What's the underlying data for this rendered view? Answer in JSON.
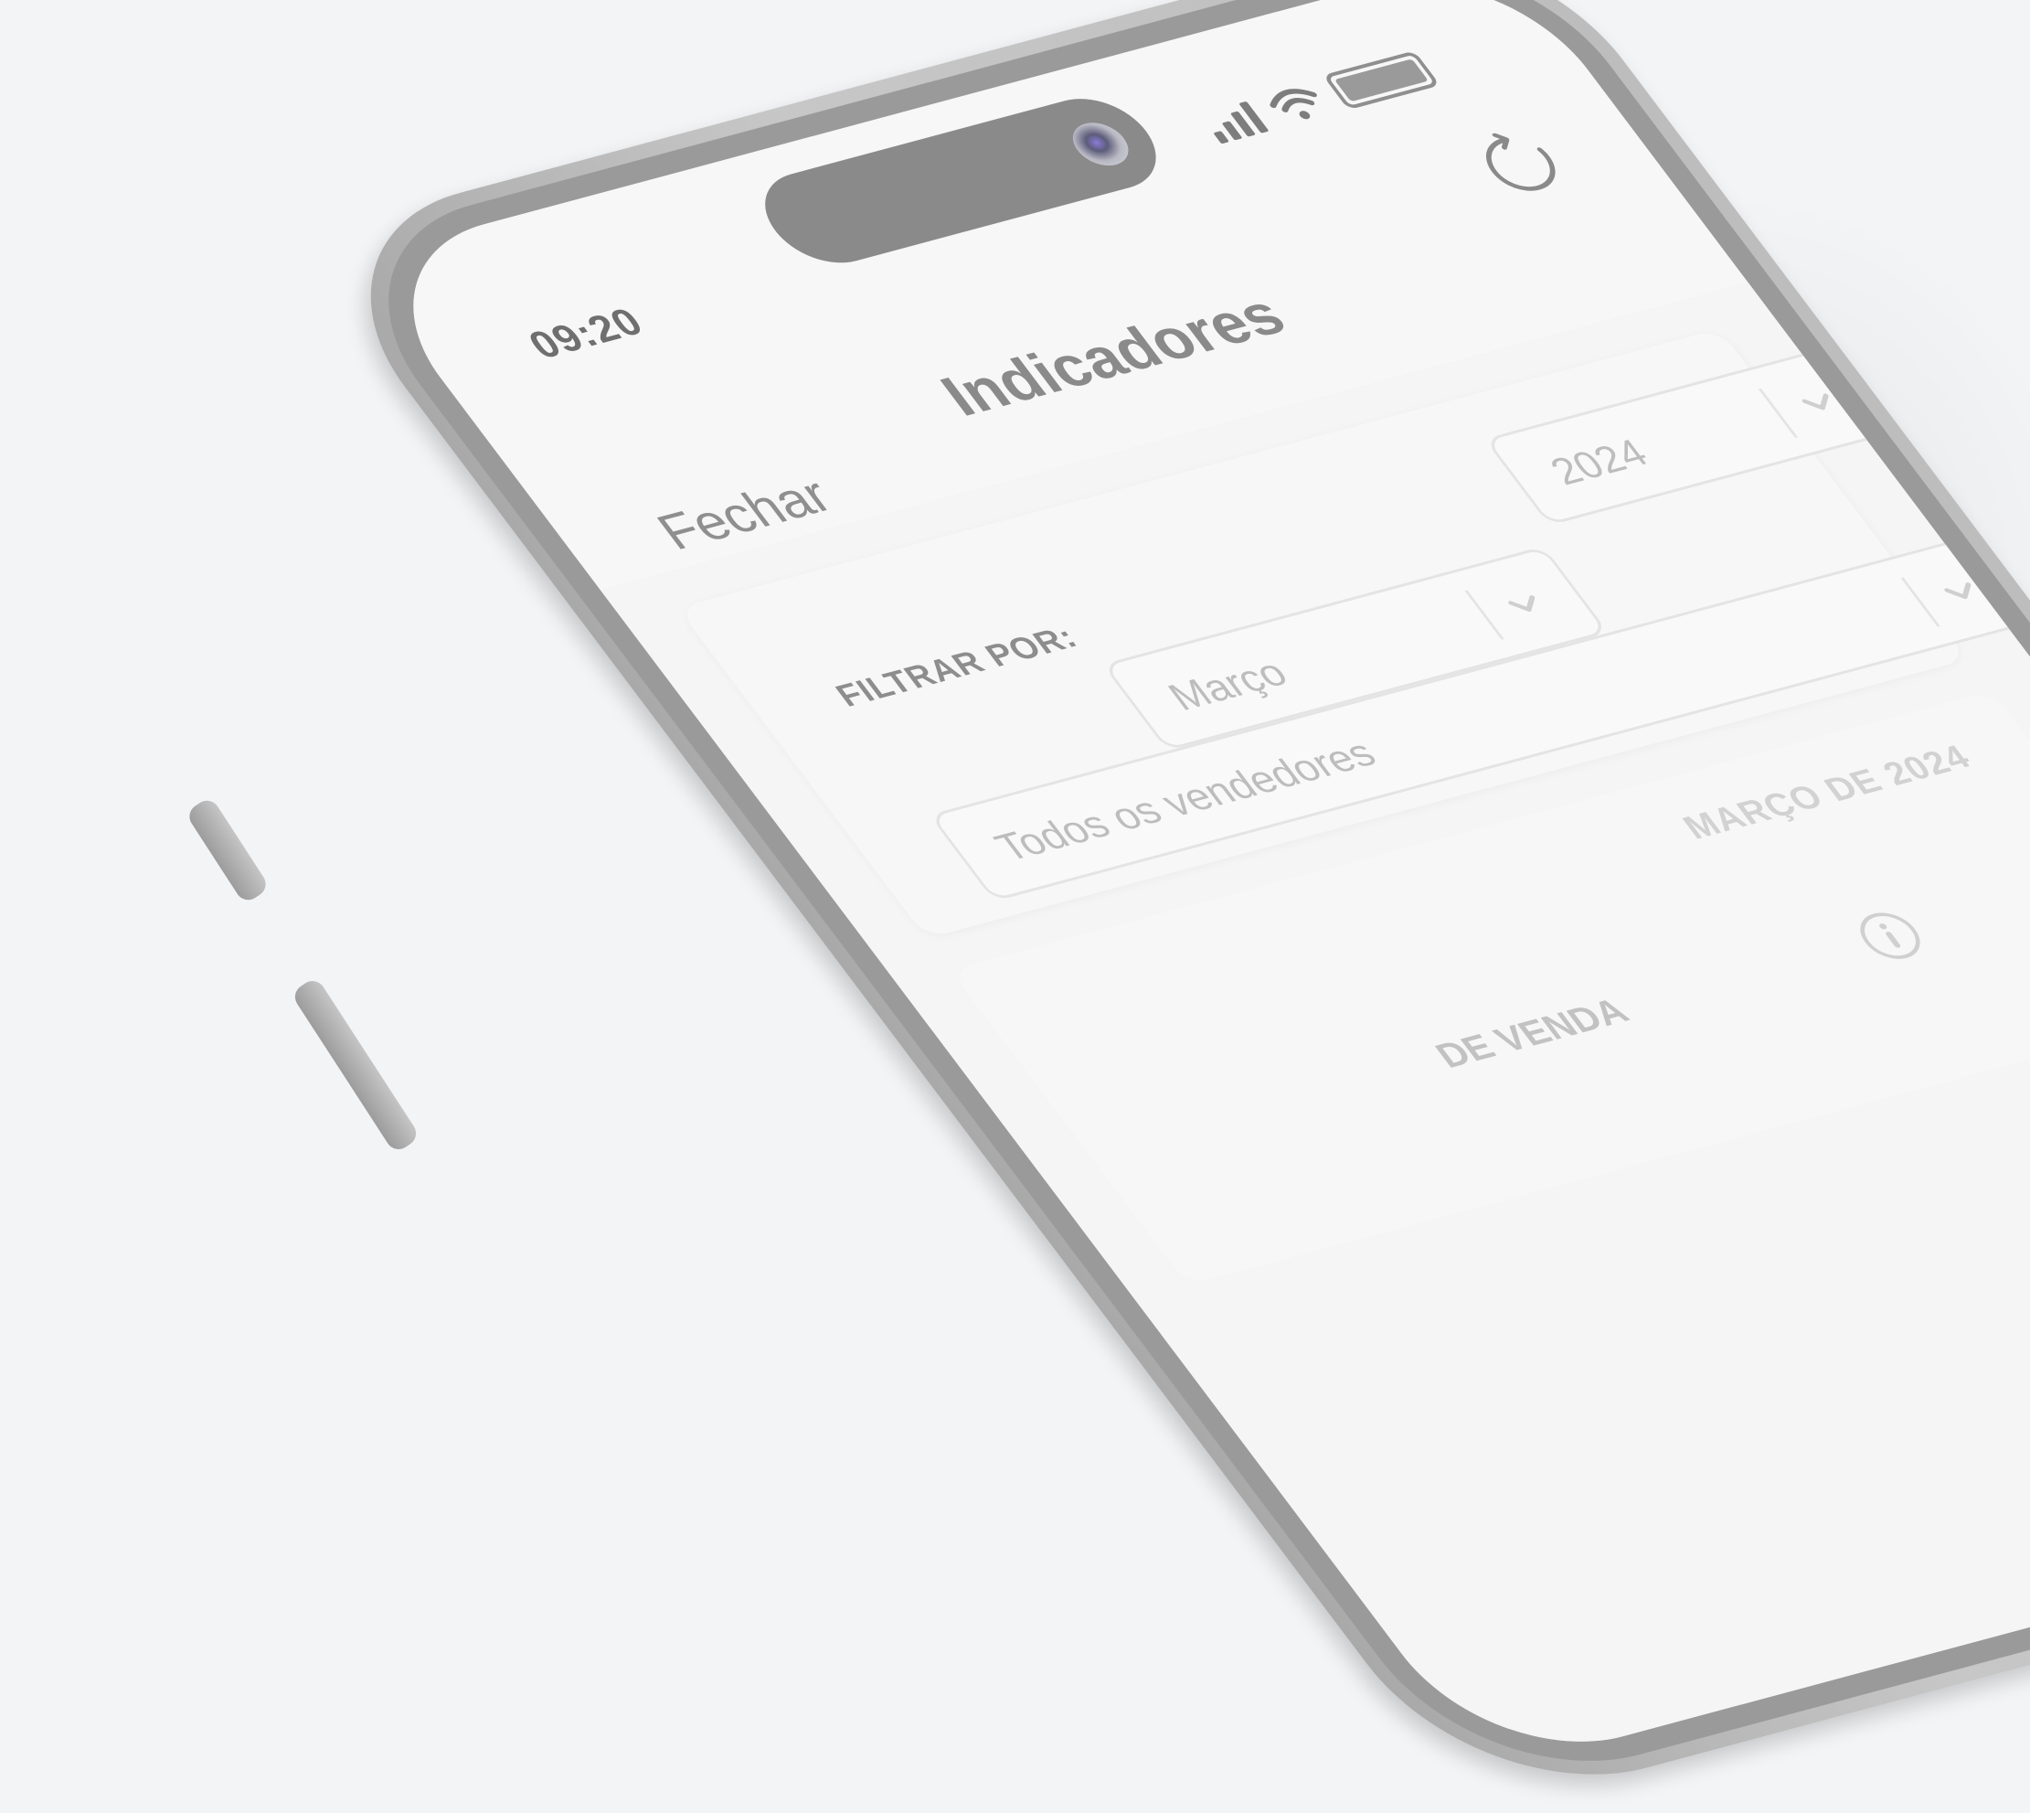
{
  "status_bar": {
    "time": "09:20",
    "icons": [
      "signal-icon",
      "wifi-icon",
      "battery-icon"
    ]
  },
  "nav": {
    "close_label": "Fechar",
    "title": "Indicadores",
    "refresh_icon": "refresh-icon"
  },
  "filters": {
    "label": "FILTRAR POR:",
    "month": "Março",
    "year": "2024",
    "seller": "Todos os vendedores"
  },
  "summary": {
    "period": "MARÇO DE 2024",
    "section_label": "DE VENDA",
    "info_icon": "info-icon"
  },
  "colors": {
    "background": "#f3f4f6",
    "frame": "#bdbdbd",
    "text_muted": "#8a8a8a"
  }
}
